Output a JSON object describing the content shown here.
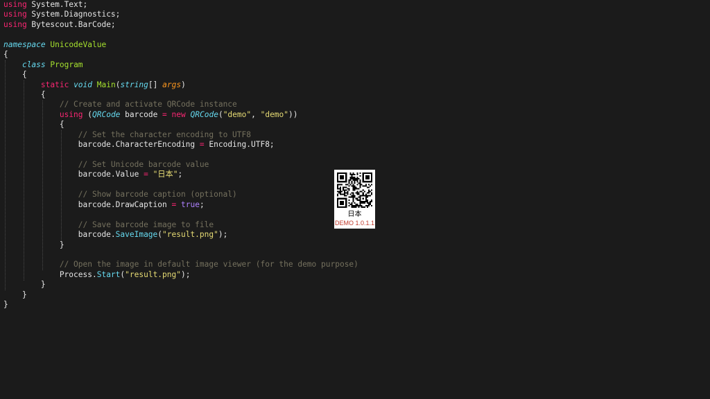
{
  "editor": {
    "theme": {
      "background": "#1b1b1b",
      "text": "#e6e6e6",
      "keyword": "#f92672",
      "type": "#a6e22e",
      "italic_type": "#66d9ef",
      "parameter": "#fd971f",
      "string": "#e6db74",
      "boolean": "#ae81ff",
      "comment": "#75715e"
    },
    "lines": [
      [
        {
          "t": "using",
          "c": "kw"
        },
        {
          "t": " System.Text;",
          "c": "id"
        }
      ],
      [
        {
          "t": "using",
          "c": "kw"
        },
        {
          "t": " System.Diagnostics;",
          "c": "id"
        }
      ],
      [
        {
          "t": "using",
          "c": "kw"
        },
        {
          "t": " Bytescout.BarCode;",
          "c": "id"
        }
      ],
      [],
      [
        {
          "t": "namespace",
          "c": "kw2"
        },
        {
          "t": " ",
          "c": "id"
        },
        {
          "t": "UnicodeValue",
          "c": "type"
        }
      ],
      [
        {
          "t": "{",
          "c": "id"
        }
      ],
      [
        {
          "t": "    ",
          "c": "id"
        },
        {
          "t": "class",
          "c": "kw2"
        },
        {
          "t": " ",
          "c": "id"
        },
        {
          "t": "Program",
          "c": "type"
        }
      ],
      [
        {
          "t": "    {",
          "c": "id"
        }
      ],
      [
        {
          "t": "        ",
          "c": "id"
        },
        {
          "t": "static",
          "c": "kw"
        },
        {
          "t": " ",
          "c": "id"
        },
        {
          "t": "void",
          "c": "kw2"
        },
        {
          "t": " ",
          "c": "id"
        },
        {
          "t": "Main",
          "c": "fn"
        },
        {
          "t": "(",
          "c": "id"
        },
        {
          "t": "string",
          "c": "kw2"
        },
        {
          "t": "[] ",
          "c": "id"
        },
        {
          "t": "args",
          "c": "param"
        },
        {
          "t": ")",
          "c": "id"
        }
      ],
      [
        {
          "t": "        {",
          "c": "id"
        }
      ],
      [
        {
          "t": "            ",
          "c": "id"
        },
        {
          "t": "// Create and activate QRCode instance",
          "c": "cmt"
        }
      ],
      [
        {
          "t": "            ",
          "c": "id"
        },
        {
          "t": "using",
          "c": "kw"
        },
        {
          "t": " (",
          "c": "id"
        },
        {
          "t": "QRCode",
          "c": "typei"
        },
        {
          "t": " barcode ",
          "c": "id"
        },
        {
          "t": "=",
          "c": "op"
        },
        {
          "t": " ",
          "c": "id"
        },
        {
          "t": "new",
          "c": "kw"
        },
        {
          "t": " ",
          "c": "id"
        },
        {
          "t": "QRCode",
          "c": "typei"
        },
        {
          "t": "(",
          "c": "id"
        },
        {
          "t": "\"demo\"",
          "c": "str"
        },
        {
          "t": ", ",
          "c": "id"
        },
        {
          "t": "\"demo\"",
          "c": "str"
        },
        {
          "t": "))",
          "c": "id"
        }
      ],
      [
        {
          "t": "            {",
          "c": "id"
        }
      ],
      [
        {
          "t": "                ",
          "c": "id"
        },
        {
          "t": "// Set the character encoding to UTF8",
          "c": "cmt"
        }
      ],
      [
        {
          "t": "                barcode.CharacterEncoding ",
          "c": "id"
        },
        {
          "t": "=",
          "c": "op"
        },
        {
          "t": " Encoding.UTF8;",
          "c": "id"
        }
      ],
      [],
      [
        {
          "t": "                ",
          "c": "id"
        },
        {
          "t": "// Set Unicode barcode value",
          "c": "cmt"
        }
      ],
      [
        {
          "t": "                barcode.Value ",
          "c": "id"
        },
        {
          "t": "=",
          "c": "op"
        },
        {
          "t": " ",
          "c": "id"
        },
        {
          "t": "\"日本\"",
          "c": "str"
        },
        {
          "t": ";",
          "c": "id"
        }
      ],
      [],
      [
        {
          "t": "                ",
          "c": "id"
        },
        {
          "t": "// Show barcode caption (optional)",
          "c": "cmt"
        }
      ],
      [
        {
          "t": "                barcode.DrawCaption ",
          "c": "id"
        },
        {
          "t": "=",
          "c": "op"
        },
        {
          "t": " ",
          "c": "id"
        },
        {
          "t": "true",
          "c": "bool"
        },
        {
          "t": ";",
          "c": "id"
        }
      ],
      [],
      [
        {
          "t": "                ",
          "c": "id"
        },
        {
          "t": "// Save barcode image to file",
          "c": "cmt"
        }
      ],
      [
        {
          "t": "                barcode.",
          "c": "id"
        },
        {
          "t": "SaveImage",
          "c": "mth"
        },
        {
          "t": "(",
          "c": "id"
        },
        {
          "t": "\"result.png\"",
          "c": "str"
        },
        {
          "t": ");",
          "c": "id"
        }
      ],
      [
        {
          "t": "            }",
          "c": "id"
        }
      ],
      [],
      [
        {
          "t": "            ",
          "c": "id"
        },
        {
          "t": "// Open the image in default image viewer (for the demo purpose)",
          "c": "cmt"
        }
      ],
      [
        {
          "t": "            Process.",
          "c": "id"
        },
        {
          "t": "Start",
          "c": "mth"
        },
        {
          "t": "(",
          "c": "id"
        },
        {
          "t": "\"result.png\"",
          "c": "str"
        },
        {
          "t": ");",
          "c": "id"
        }
      ],
      [
        {
          "t": "        }",
          "c": "id"
        }
      ],
      [
        {
          "t": "    }",
          "c": "id"
        }
      ],
      [
        {
          "t": "}",
          "c": "id"
        }
      ]
    ]
  },
  "barcode_preview": {
    "caption": "日本",
    "demo_label": "DEMO 1.0.1.1",
    "demo_color": "#c0392b"
  }
}
